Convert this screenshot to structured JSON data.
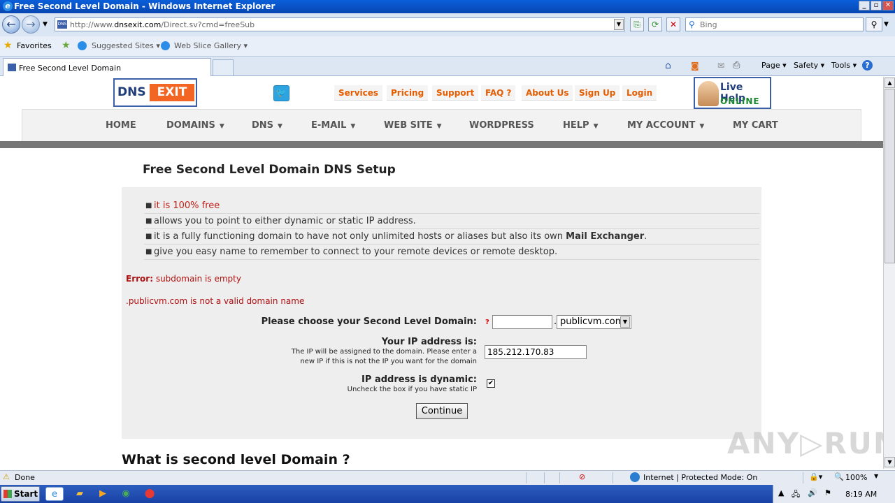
{
  "window": {
    "title": "Free Second Level Domain - Windows Internet Explorer",
    "min": "_",
    "max": "▫",
    "close": "✕"
  },
  "nav": {
    "url_prefix": "http://www.",
    "url_host": "dnsexit.com",
    "url_path": "/Direct.sv?cmd=freeSub",
    "search_placeholder": "Bing"
  },
  "favorites": {
    "favorites_label": "Favorites",
    "suggested_label": "Suggested Sites ▾",
    "webslice_label": "Web Slice Gallery ▾"
  },
  "tab": {
    "label": "Free Second Level Domain"
  },
  "commandbar": {
    "page": "Page ▾",
    "safety": "Safety ▾",
    "tools": "Tools ▾"
  },
  "site": {
    "logo_left": "DNS",
    "logo_right": "EXIT",
    "top_links": [
      "Services",
      "Pricing",
      "Support",
      "FAQ ?",
      "About Us",
      "Sign Up",
      "Login"
    ],
    "livehelp_title": "Live Help",
    "livehelp_status": "ONLINE",
    "mainnav": [
      "HOME",
      "DOMAINS",
      "DNS",
      "E-MAIL",
      "WEB SITE",
      "WORDPRESS",
      "HELP",
      "MY ACCOUNT",
      "MY CART"
    ],
    "mainnav_carets": [
      "",
      "▼",
      "▼",
      "▼",
      "▼",
      "",
      "▼",
      "▼",
      ""
    ]
  },
  "content": {
    "heading": "Free Second Level Domain DNS Setup",
    "bullets": [
      "it is 100% free",
      "allows you to point to either dynamic or static IP address.",
      "it is a fully functioning domain to have not only unlimited hosts or aliases but also its own ",
      "give you easy name to remember to connect to your remote devices or remote desktop."
    ],
    "bullet_bold": "Mail Exchanger",
    "bullet_bold_suffix": ".",
    "error_label": "Error:",
    "error_text": " subdomain is empty",
    "error2": ".publicvm.com is not a valid domain name",
    "domain_label": "Please choose your Second Level Domain",
    "qmark": "?",
    "subdomain_value": "",
    "domain_select": "publicvm.com",
    "ip_label": "Your IP address is",
    "ip_hint1": "The IP will be assigned to the domain. Please enter a",
    "ip_hint2": "new IP if this is not the IP you want for the domain",
    "ip_value": "185.212.170.83",
    "dynamic_label": "IP address is dynamic",
    "dynamic_hint": "Uncheck the box if you have static IP",
    "dynamic_checked": true,
    "continue_label": "Continue",
    "heading2": "What is second level Domain ?"
  },
  "watermark": "ANY▷RUN",
  "status": {
    "left": "Done",
    "zone": "Internet | Protected Mode: On",
    "zoom": "100%"
  },
  "taskbar": {
    "start": "Start",
    "clock": "8:19 AM"
  }
}
